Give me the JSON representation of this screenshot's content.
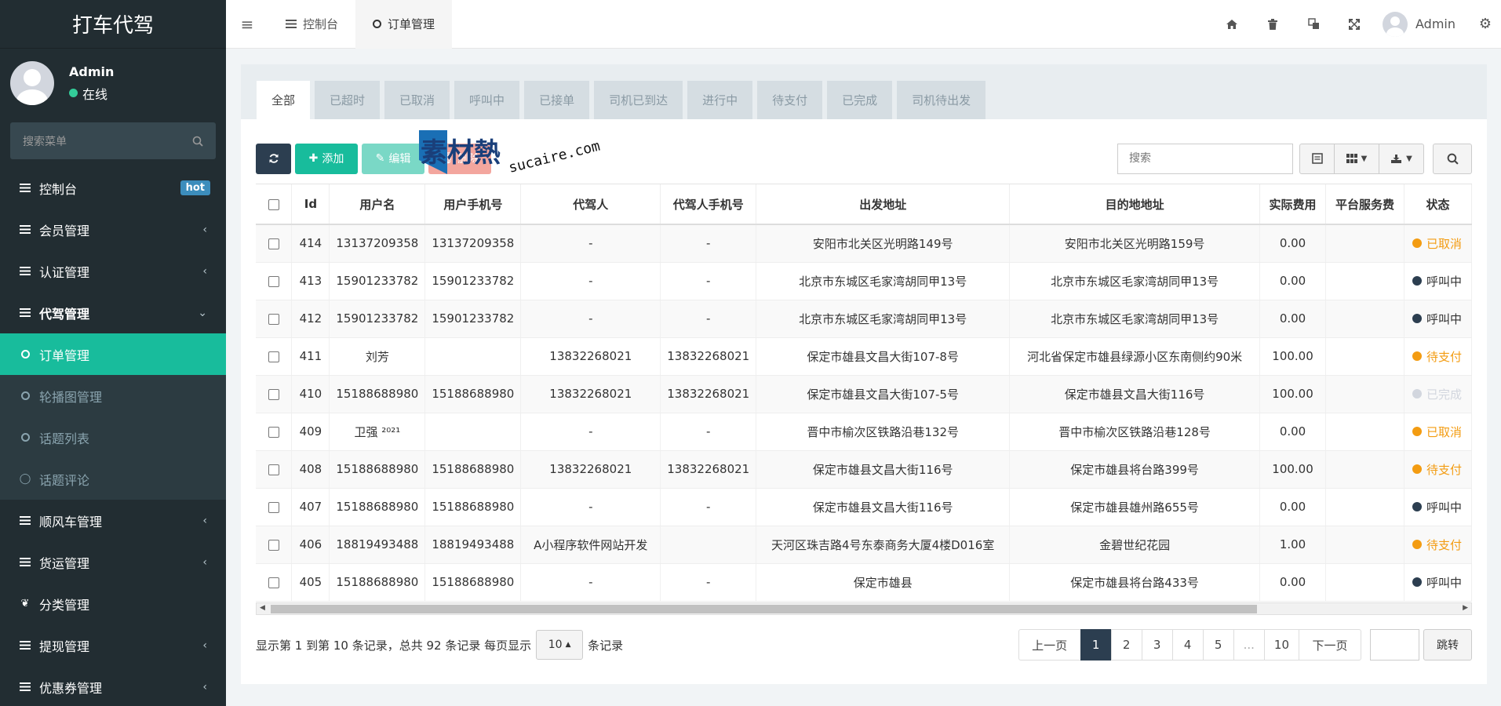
{
  "sidebar": {
    "logo": "打车代驾",
    "user_name": "Admin",
    "user_status": "在线",
    "search_placeholder": "搜索菜单",
    "items": [
      {
        "label": "控制台",
        "badge": "hot"
      },
      {
        "label": "会员管理"
      },
      {
        "label": "认证管理"
      },
      {
        "label": "代驾管理"
      },
      {
        "label": "顺风车管理"
      },
      {
        "label": "货运管理"
      },
      {
        "label": "分类管理"
      },
      {
        "label": "提现管理"
      },
      {
        "label": "优惠券管理"
      }
    ],
    "submenu": [
      "订单管理",
      "轮播图管理",
      "话题列表",
      "话题评论"
    ]
  },
  "topbar": {
    "tabs": [
      "控制台",
      "订单管理"
    ],
    "user": "Admin"
  },
  "status_tabs": [
    "全部",
    "已超时",
    "已取消",
    "呼叫中",
    "已接单",
    "司机已到达",
    "进行中",
    "待支付",
    "已完成",
    "司机待出发"
  ],
  "toolbar": {
    "add_label": "添加",
    "edit_label": "编辑",
    "delete_label": "删除",
    "search_placeholder": "搜索"
  },
  "watermark": {
    "main": "素材熱",
    "sub": "sucaire.com"
  },
  "table": {
    "columns": [
      "Id",
      "用户名",
      "用户手机号",
      "代驾人",
      "代驾人手机号",
      "出发地址",
      "目的地地址",
      "实际费用",
      "平台服务费",
      "状态"
    ],
    "rows": [
      {
        "id": "414",
        "username": "13137209358",
        "phone": "13137209358",
        "driver": "-",
        "driver_phone": "-",
        "from": "安阳市北关区光明路149号",
        "to": "安阳市北关区光明路159号",
        "fee": "0.00",
        "service": "",
        "status": "已取消",
        "status_color": "#f39c12"
      },
      {
        "id": "413",
        "username": "15901233782",
        "phone": "15901233782",
        "driver": "-",
        "driver_phone": "-",
        "from": "北京市东城区毛家湾胡同甲13号",
        "to": "北京市东城区毛家湾胡同甲13号",
        "fee": "0.00",
        "service": "",
        "status": "呼叫中",
        "status_color": "#2c3e50"
      },
      {
        "id": "412",
        "username": "15901233782",
        "phone": "15901233782",
        "driver": "-",
        "driver_phone": "-",
        "from": "北京市东城区毛家湾胡同甲13号",
        "to": "北京市东城区毛家湾胡同甲13号",
        "fee": "0.00",
        "service": "",
        "status": "呼叫中",
        "status_color": "#2c3e50"
      },
      {
        "id": "411",
        "username": "刘芳",
        "phone": "",
        "driver": "13832268021",
        "driver_phone": "13832268021",
        "from": "保定市雄县文昌大街107-8号",
        "to": "河北省保定市雄县绿源小区东南侧约90米",
        "fee": "100.00",
        "service": "",
        "status": "待支付",
        "status_color": "#f39c12"
      },
      {
        "id": "410",
        "username": "15188688980",
        "phone": "15188688980",
        "driver": "13832268021",
        "driver_phone": "13832268021",
        "from": "保定市雄县文昌大街107-5号",
        "to": "保定市雄县文昌大街116号",
        "fee": "100.00",
        "service": "",
        "status": "已完成",
        "status_color": "#d2d6de"
      },
      {
        "id": "409",
        "username": "卫强 ²⁰²¹",
        "phone": "",
        "driver": "-",
        "driver_phone": "-",
        "from": "晋中市榆次区铁路沿巷132号",
        "to": "晋中市榆次区铁路沿巷128号",
        "fee": "0.00",
        "service": "",
        "status": "已取消",
        "status_color": "#f39c12"
      },
      {
        "id": "408",
        "username": "15188688980",
        "phone": "15188688980",
        "driver": "13832268021",
        "driver_phone": "13832268021",
        "from": "保定市雄县文昌大街116号",
        "to": "保定市雄县将台路399号",
        "fee": "100.00",
        "service": "",
        "status": "待支付",
        "status_color": "#f39c12"
      },
      {
        "id": "407",
        "username": "15188688980",
        "phone": "15188688980",
        "driver": "-",
        "driver_phone": "-",
        "from": "保定市雄县文昌大街116号",
        "to": "保定市雄县雄州路655号",
        "fee": "0.00",
        "service": "",
        "status": "呼叫中",
        "status_color": "#2c3e50"
      },
      {
        "id": "406",
        "username": "18819493488",
        "phone": "18819493488",
        "driver": "A小程序软件网站开发",
        "driver_phone": "",
        "from": "天河区珠吉路4号东泰商务大厦4楼D016室",
        "to": "金碧世纪花园",
        "fee": "1.00",
        "service": "",
        "status": "待支付",
        "status_color": "#f39c12"
      },
      {
        "id": "405",
        "username": "15188688980",
        "phone": "15188688980",
        "driver": "-",
        "driver_phone": "-",
        "from": "保定市雄县",
        "to": "保定市雄县将台路433号",
        "fee": "0.00",
        "service": "",
        "status": "呼叫中",
        "status_color": "#2c3e50"
      }
    ]
  },
  "footer": {
    "summary": "显示第 1 到第 10 条记录，总共 92 条记录 每页显示",
    "page_size": "10",
    "suffix": "条记录",
    "prev": "上一页",
    "next": "下一页",
    "pages": [
      "1",
      "2",
      "3",
      "4",
      "5",
      "...",
      "10"
    ],
    "jump": "跳转"
  },
  "colors": {
    "accent": "#18bc9c",
    "dark": "#2c3e50",
    "sidebar": "#222d32"
  }
}
